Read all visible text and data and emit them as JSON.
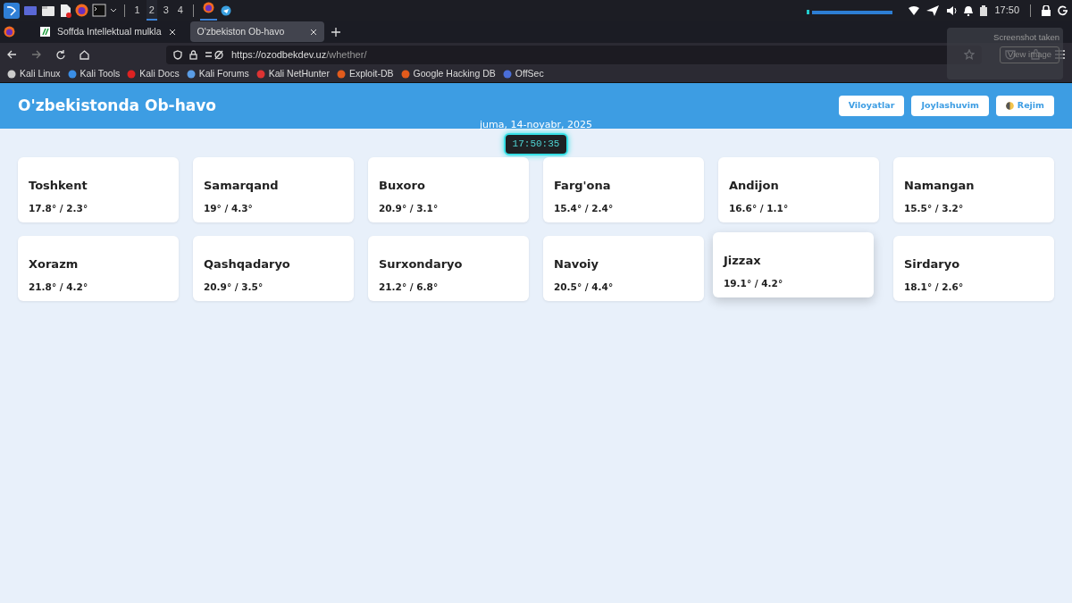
{
  "taskbar": {
    "workspaces": [
      {
        "label": "1",
        "selected": false
      },
      {
        "label": "2",
        "selected": true
      },
      {
        "label": "3",
        "selected": false
      },
      {
        "label": "4",
        "selected": false
      }
    ],
    "clock": "17:50"
  },
  "browser": {
    "tabs": [
      {
        "label": "Soffda Intellektual mulkla",
        "selected": false
      },
      {
        "label": "O'zbekiston Ob-havo",
        "selected": true
      }
    ],
    "url": {
      "host": "https://ozodbekdev.uz",
      "path": "/whether/"
    },
    "bookmarks": [
      "Kali Linux",
      "Kali Tools",
      "Kali Docs",
      "Kali Forums",
      "Kali NetHunter",
      "Exploit-DB",
      "Google Hacking DB",
      "OffSec"
    ]
  },
  "notification": {
    "title": "Screenshot taken",
    "action": "View image"
  },
  "page": {
    "title": "O'zbekistonda Ob-havo",
    "buttons": [
      "Viloyatlar",
      "Joylashuvim",
      "Rejim"
    ],
    "date": "juma, 14-noyabr, 2025",
    "time": "17:50:35",
    "cities": [
      {
        "name": "Toshkent",
        "temps": "17.8° / 2.3°",
        "hovered": false
      },
      {
        "name": "Samarqand",
        "temps": "19° / 4.3°",
        "hovered": false
      },
      {
        "name": "Buxoro",
        "temps": "20.9° / 3.1°",
        "hovered": false
      },
      {
        "name": "Farg'ona",
        "temps": "15.4° / 2.4°",
        "hovered": false
      },
      {
        "name": "Andijon",
        "temps": "16.6° / 1.1°",
        "hovered": false
      },
      {
        "name": "Namangan",
        "temps": "15.5° / 3.2°",
        "hovered": false
      },
      {
        "name": "Xorazm",
        "temps": "21.8° / 4.2°",
        "hovered": false
      },
      {
        "name": "Qashqadaryo",
        "temps": "20.9° / 3.5°",
        "hovered": false
      },
      {
        "name": "Surxondaryo",
        "temps": "21.2° / 6.8°",
        "hovered": false
      },
      {
        "name": "Navoiy",
        "temps": "20.5° / 4.4°",
        "hovered": false
      },
      {
        "name": "Jizzax",
        "temps": "19.1° / 4.2°",
        "hovered": true
      },
      {
        "name": "Sirdaryo",
        "temps": "18.1° / 2.6°",
        "hovered": false
      }
    ]
  }
}
